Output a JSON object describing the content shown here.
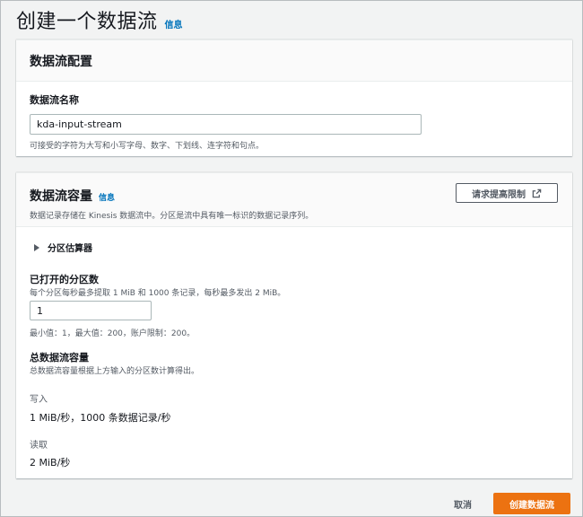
{
  "page": {
    "title": "创建一个数据流",
    "info_link": "信息"
  },
  "config_panel": {
    "title": "数据流配置",
    "name_field": {
      "label": "数据流名称",
      "value": "kda-input-stream",
      "constraint": "可接受的字符为大写和小写字母、数字、下划线、连字符和句点。"
    }
  },
  "capacity_panel": {
    "title": "数据流容量",
    "info_link": "信息",
    "description": "数据记录存储在 Kinesis 数据流中。分区是流中具有唯一标识的数据记录序列。",
    "request_limit_button": "请求提高限制",
    "request_limit_icon": "external-link-icon",
    "expander": {
      "label": "分区估算器",
      "icon": "caret-right-icon",
      "expanded": false
    },
    "shards_field": {
      "label": "已打开的分区数",
      "description": "每个分区每秒最多提取 1 MiB 和 1000 条记录，每秒最多发出 2 MiB。",
      "value": "1",
      "constraint": "最小值：1，最大值：200，账户限制：200。"
    },
    "total_capacity": {
      "label": "总数据流容量",
      "description": "总数据流容量根据上方输入的分区数计算得出。",
      "write_label": "写入",
      "write_value": "1 MiB/秒，1000 条数据记录/秒",
      "read_label": "读取",
      "read_value": "2 MiB/秒"
    }
  },
  "footer": {
    "cancel_label": "取消",
    "create_label": "创建数据流"
  },
  "colors": {
    "primary": "#ec7211",
    "link": "#0073bb",
    "background": "#f2f3f3",
    "text": "#16191f",
    "secondary_text": "#545b64"
  }
}
